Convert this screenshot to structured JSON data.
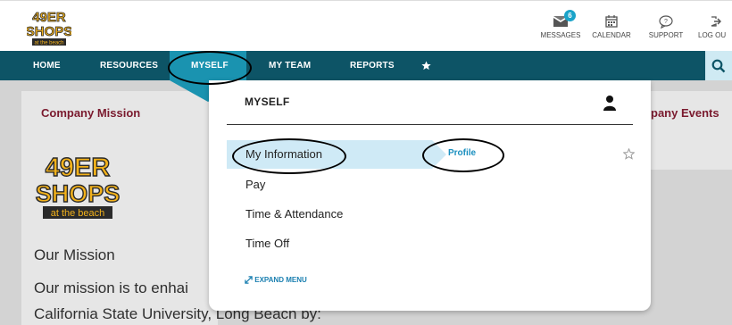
{
  "header": {
    "logo_text": [
      "49ER",
      "SHOPS",
      "at the beach"
    ],
    "utilities": [
      {
        "label": "MESSAGES",
        "icon": "messages-icon",
        "badge": "6"
      },
      {
        "label": "CALENDAR",
        "icon": "calendar-icon"
      },
      {
        "label": "SUPPORT",
        "icon": "support-icon"
      },
      {
        "label": "LOG OU",
        "icon": "logout-icon"
      }
    ]
  },
  "nav": {
    "items": [
      "HOME",
      "RESOURCES",
      "MYSELF",
      "MY TEAM",
      "REPORTS"
    ],
    "star_icon": "star-icon",
    "search_icon": "search-icon"
  },
  "background": {
    "left_card_title": "Company Mission",
    "right_card_title": "pany Events",
    "logo_text": [
      "49ER",
      "SHOPS",
      "at the beach"
    ],
    "mission_heading": "Our Mission",
    "mission_line1": "Our mission is to enhai",
    "mission_line2": "California State University, Long Beach by:"
  },
  "dropdown": {
    "title": "MYSELF",
    "person_icon": "person-icon",
    "items": [
      "My Information",
      "Pay",
      "Time & Attendance",
      "Time Off"
    ],
    "submenu_label": "Profile",
    "star_icon": "star-outline-icon",
    "expand_label": "EXPAND MENU",
    "expand_icon": "expand-icon"
  },
  "colors": {
    "nav_bg": "#0d5466",
    "active_tab": "#1a93b0",
    "highlight": "#cfeaf6",
    "card_title": "#7a1a2e",
    "badge": "#1aa3c9"
  }
}
